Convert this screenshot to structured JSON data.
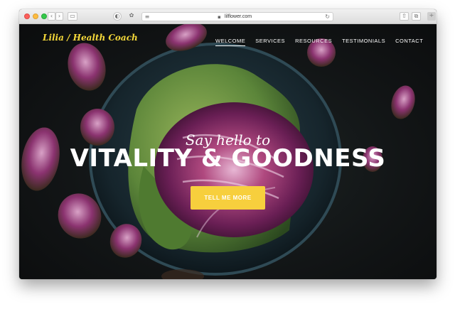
{
  "browser": {
    "url": "lilflower.com",
    "back_glyph": "‹",
    "forward_glyph": "›",
    "reload_glyph": "↻",
    "lock_glyph": "🔒"
  },
  "site": {
    "logo": "Lilia / Health Coach",
    "nav": [
      "WELCOME",
      "SERVICES",
      "RESOURCES",
      "TESTIMONIALS",
      "CONTACT"
    ],
    "active_nav": "WELCOME"
  },
  "hero": {
    "tagline": "Say hello to",
    "headline": "VITALITY & GOODNESS",
    "cta": "TELL ME MORE"
  },
  "colors": {
    "accent": "#f7cf3d",
    "logo": "#f4d83a",
    "background": "#121516",
    "cabbage_purple": "#7a2e63",
    "cabbage_green": "#5f8a3a"
  },
  "icons": [
    "close-icon",
    "minimize-icon",
    "zoom-icon",
    "back-icon",
    "forward-icon",
    "sidebar-icon",
    "lock-icon",
    "reload-icon",
    "share-icon",
    "tabs-icon",
    "new-tab-icon"
  ]
}
